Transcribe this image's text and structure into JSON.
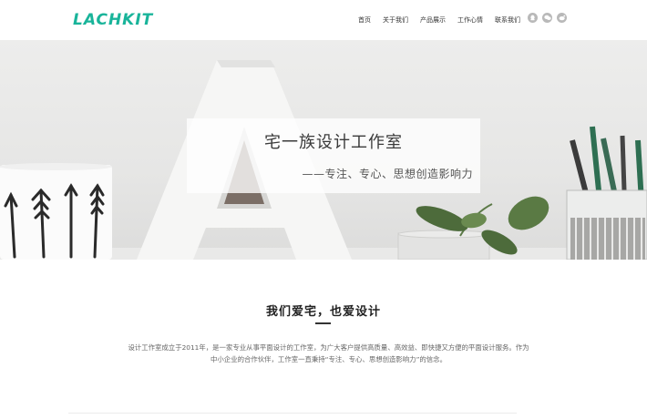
{
  "brand": {
    "logo_text": "LACHKIT",
    "accent": "#19b49a"
  },
  "nav": {
    "items": [
      {
        "label": "首页"
      },
      {
        "label": "关于我们"
      },
      {
        "label": "产品展示"
      },
      {
        "label": "工作心情"
      },
      {
        "label": "联系我们"
      }
    ],
    "social_icons": [
      "qq-icon",
      "wechat-icon",
      "weibo-icon"
    ]
  },
  "hero": {
    "title": "宅一族设计工作室",
    "subtitle": "——专注、专心、思想创造影响力"
  },
  "about": {
    "title": "我们爱宅，也爱设计",
    "text": "设计工作室成立于2011年，是一家专业从事平面设计的工作室，为广大客户提供高质量、高效益、即快捷又方便的平面设计服务。作为中小企业的合作伙伴，工作室一直秉持“专注、专心、思想创造影响力”的信念。"
  }
}
